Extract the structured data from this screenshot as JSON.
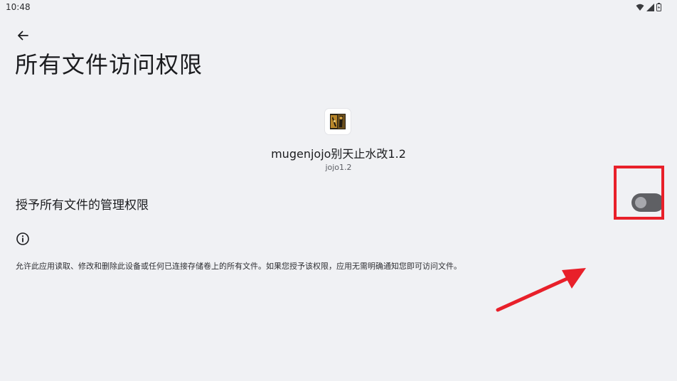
{
  "status_bar": {
    "time": "10:48",
    "icons": [
      "wifi-icon",
      "signal-icon",
      "battery-icon"
    ]
  },
  "header": {
    "back_icon": "arrow-left-icon",
    "title": "所有文件访问权限"
  },
  "app": {
    "name": "mugenjojo别天止水改1.2",
    "version": "jojo1.2"
  },
  "permission": {
    "label": "授予所有文件的管理权限",
    "enabled": false
  },
  "info": {
    "icon": "info-icon",
    "description": "允许此应用读取、修改和删除此设备或任何已连接存储卷上的所有文件。如果您授予该权限，应用无需明确通知您即可访问文件。"
  },
  "colors": {
    "background": "#f0f1f4",
    "toggle_track_off": "#5f6064",
    "toggle_knob_off": "#a7a8ad",
    "annotation_red": "#e8202a"
  }
}
